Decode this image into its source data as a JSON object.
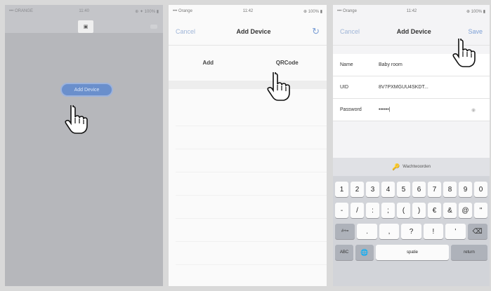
{
  "panel1": {
    "status_left": "••• ORANGE",
    "status_time": "11:40",
    "status_right": "⊕ ✦ 100% ▮",
    "add_button_label": "Add Device"
  },
  "panel2": {
    "status_left": "••• Orange",
    "status_time": "11:42",
    "status_right": "⊕ 100% ▮",
    "nav_cancel": "Cancel",
    "nav_title": "Add Device",
    "nav_refresh": "↻",
    "tabs": [
      "Add",
      "QRCode"
    ]
  },
  "panel3": {
    "status_left": "••• Orange",
    "status_time": "11:42",
    "status_right": "⊕ 100% ▮",
    "nav_cancel": "Cancel",
    "nav_title": "Add Device",
    "nav_save": "Save",
    "fields": [
      {
        "label": "Name",
        "value": "Baby room"
      },
      {
        "label": "UID",
        "value": "8V7PXMGUU4SKDT..."
      },
      {
        "label": "Password",
        "value": "••••••|"
      }
    ],
    "eye_icon": "eye-icon",
    "keyboard": {
      "suggestion": "Wachtwoorden",
      "row1": [
        "1",
        "2",
        "3",
        "4",
        "5",
        "6",
        "7",
        "8",
        "9",
        "0"
      ],
      "row2": [
        "-",
        "/",
        ":",
        ";",
        "(",
        ")",
        "€",
        "&",
        "@",
        "\""
      ],
      "row3": [
        "#+=",
        ".",
        ",",
        "?",
        "!",
        "'",
        "⌫"
      ],
      "row4": [
        "ABC",
        "🌐",
        "spatie",
        "return"
      ]
    }
  },
  "colors": {
    "accent": "#6a8fcc",
    "link": "#7da0d6"
  }
}
